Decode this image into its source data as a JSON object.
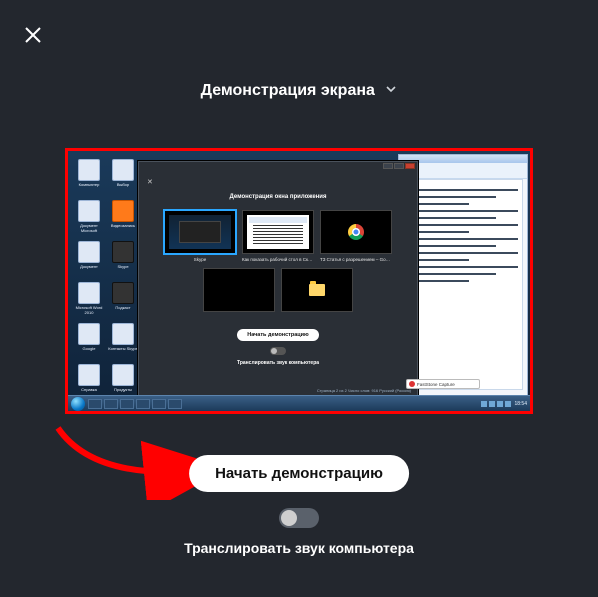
{
  "close_icon": "close",
  "title": "Демонстрация экрана",
  "preview": {
    "nested_modal": {
      "header": "Демонстрация окна приложения",
      "thumbs": [
        {
          "label": "Skype"
        },
        {
          "label": "Как показать рабочий стол в Скайпе…"
        },
        {
          "label": "ТЗ Статья с разрешением – Google Доку…"
        },
        {
          "label": ""
        },
        {
          "label": ""
        }
      ],
      "cta": "Начать демонстрацию",
      "caption": "Транслировать звук компьютера",
      "status": "Страница 2 из 2    Число слов: 916    Русский (Россия)"
    },
    "fastone_label": "FastStone Capture",
    "taskbar_time": "18:54",
    "desktop_icons": [
      "Компьютер",
      "Выбор",
      "Документ Microsoft",
      "Видеозапись",
      "Документ",
      "Skype",
      "Microsoft Word 2010",
      "Подкаст",
      "Google",
      "Контакты Skype",
      "Справка",
      "Продукты"
    ]
  },
  "cta_label": "Начать демонстрацию",
  "audio_caption": "Транслировать звук компьютера"
}
